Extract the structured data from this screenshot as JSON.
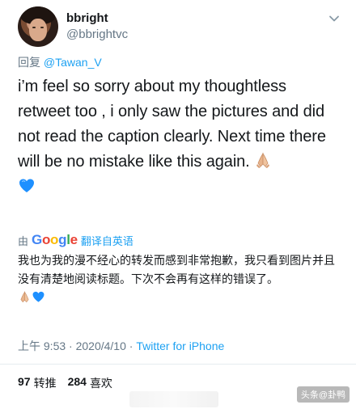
{
  "user": {
    "display_name": "bbright",
    "handle": "@bbrightvc"
  },
  "reply": {
    "prefix": "回复 ",
    "mention": "@Tawan_V"
  },
  "tweet": {
    "text": "i’m feel so sorry about my thoughtless retweet too , i only saw the pictures and did not read the caption clearly. Next time there will be no mistake like this again."
  },
  "translation": {
    "by": "由",
    "provider_logo_text": "Google",
    "link": "翻译自英语",
    "text": "我也为我的漫不经心的转发而感到非常抱歉，我只看到图片并且没有清楚地阅读标题。下次不会再有这样的错误了。"
  },
  "meta": {
    "time": "上午 9:53",
    "separator1": " · ",
    "date": "2020/4/10",
    "separator2": " · ",
    "client": "Twitter for iPhone"
  },
  "stats": {
    "retweets_count": "97",
    "retweets_label": "转推",
    "likes_count": "284",
    "likes_label": "喜欢"
  },
  "watermark": "头条@卦鸭",
  "icons": {
    "more": "chevron-down-icon",
    "emoji1": "folded-hands-emoji",
    "emoji2": "blue-heart-emoji"
  },
  "colors": {
    "link": "#1da1f2",
    "secondary": "#657786",
    "heart": "#1e90ff"
  }
}
